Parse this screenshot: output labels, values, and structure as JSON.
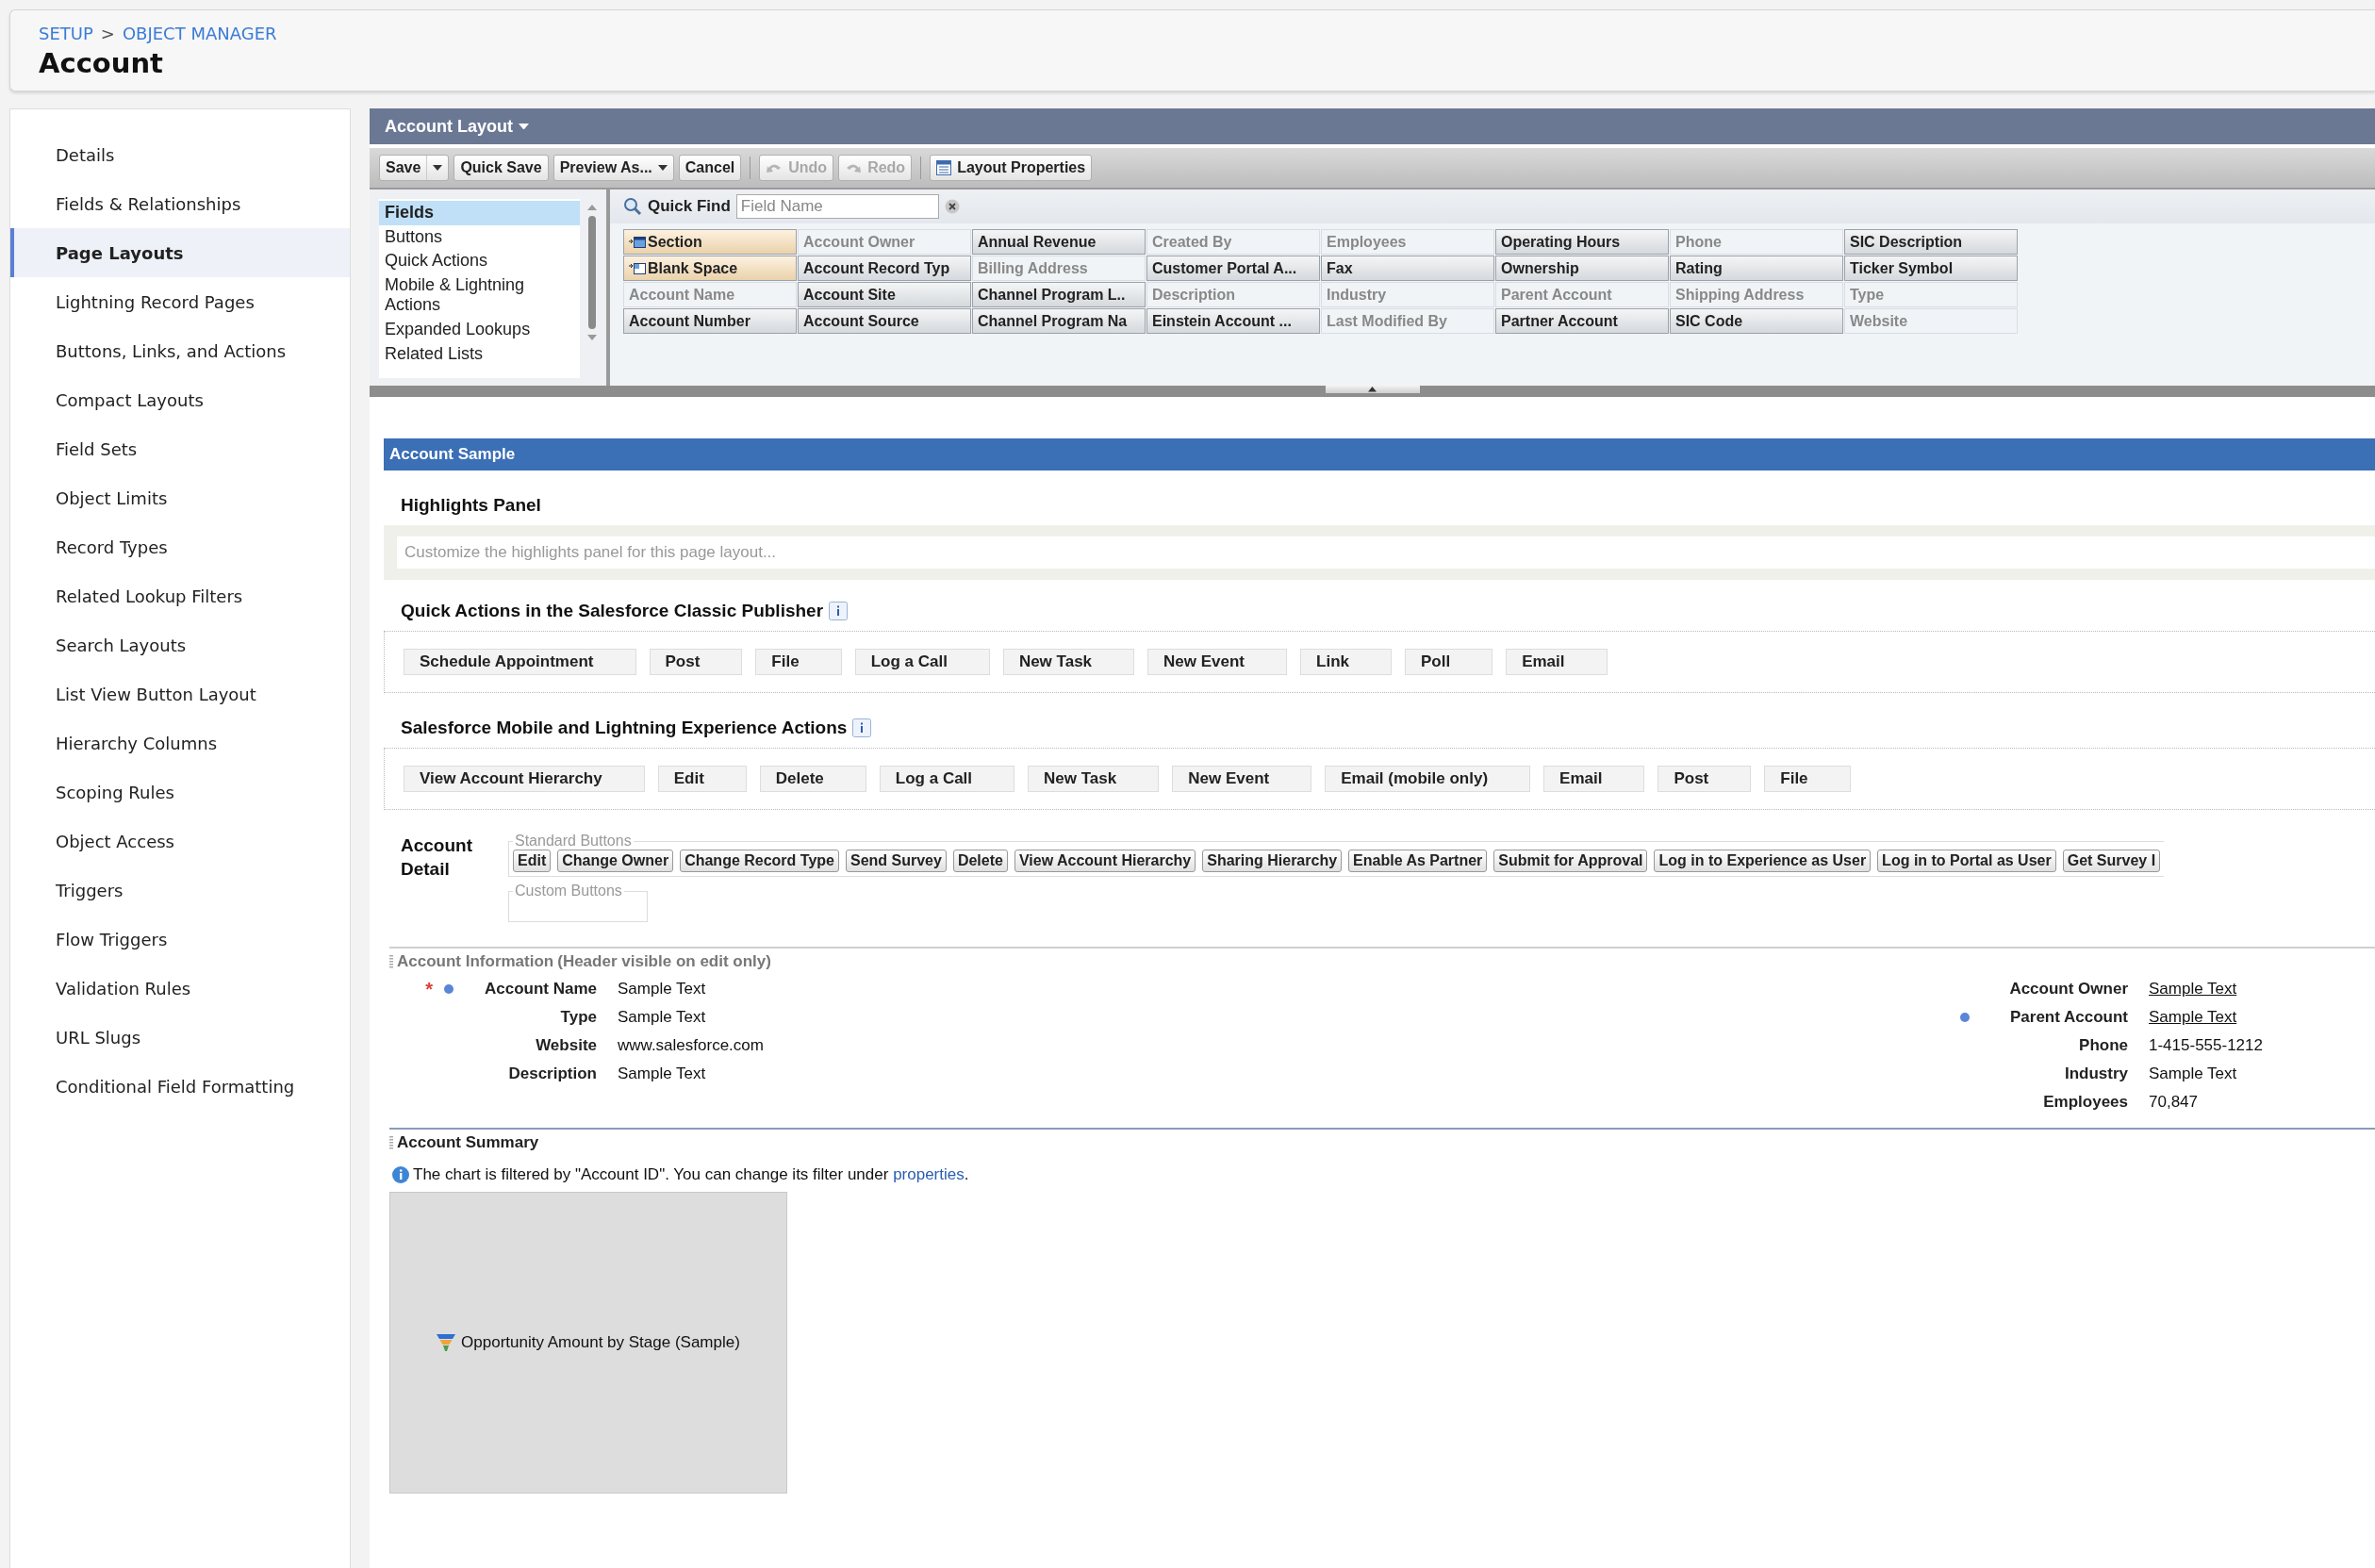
{
  "header": {
    "breadcrumb": [
      {
        "label": "SETUP"
      },
      {
        "label": "OBJECT MANAGER"
      }
    ],
    "separator": ">",
    "title": "Account"
  },
  "sidebar": {
    "items": [
      {
        "label": "Details",
        "selected": false
      },
      {
        "label": "Fields & Relationships",
        "selected": false
      },
      {
        "label": "Page Layouts",
        "selected": true
      },
      {
        "label": "Lightning Record Pages",
        "selected": false
      },
      {
        "label": "Buttons, Links, and Actions",
        "selected": false
      },
      {
        "label": "Compact Layouts",
        "selected": false
      },
      {
        "label": "Field Sets",
        "selected": false
      },
      {
        "label": "Object Limits",
        "selected": false
      },
      {
        "label": "Record Types",
        "selected": false
      },
      {
        "label": "Related Lookup Filters",
        "selected": false
      },
      {
        "label": "Search Layouts",
        "selected": false
      },
      {
        "label": "List View Button Layout",
        "selected": false
      },
      {
        "label": "Hierarchy Columns",
        "selected": false
      },
      {
        "label": "Scoping Rules",
        "selected": false
      },
      {
        "label": "Object Access",
        "selected": false
      },
      {
        "label": "Triggers",
        "selected": false
      },
      {
        "label": "Flow Triggers",
        "selected": false
      },
      {
        "label": "Validation Rules",
        "selected": false
      },
      {
        "label": "URL Slugs",
        "selected": false
      },
      {
        "label": "Conditional Field Formatting",
        "selected": false
      }
    ]
  },
  "layout_editor": {
    "title": "Account Layout",
    "toolbar": [
      {
        "label": "Save",
        "kind": "split",
        "disabled": false
      },
      {
        "label": "Quick Save",
        "kind": "plain",
        "disabled": false
      },
      {
        "label": "Preview As...",
        "kind": "menu",
        "disabled": false
      },
      {
        "label": "Cancel",
        "kind": "plain",
        "disabled": false
      },
      {
        "kind": "separator"
      },
      {
        "label": "Undo",
        "kind": "undo",
        "disabled": true
      },
      {
        "label": "Redo",
        "kind": "redo",
        "disabled": true
      },
      {
        "kind": "separator"
      },
      {
        "label": "Layout Properties",
        "kind": "properties",
        "disabled": false
      }
    ],
    "categories": [
      {
        "label": "Fields",
        "selected": true
      },
      {
        "label": "Buttons",
        "selected": false
      },
      {
        "label": "Quick Actions",
        "selected": false
      },
      {
        "label": "Mobile & Lightning Actions",
        "selected": false
      },
      {
        "label": "Expanded Lookups",
        "selected": false
      },
      {
        "label": "Related Lists",
        "selected": false
      }
    ],
    "quick_find": {
      "label": "Quick Find",
      "placeholder": "Field Name"
    },
    "fields": [
      {
        "label": "Section",
        "kind": "section",
        "placed": false
      },
      {
        "label": "Account Owner",
        "kind": "field",
        "placed": true
      },
      {
        "label": "Annual Revenue",
        "kind": "field",
        "placed": false
      },
      {
        "label": "Created By",
        "kind": "field",
        "placed": true
      },
      {
        "label": "Employees",
        "kind": "field",
        "placed": true
      },
      {
        "label": "Operating Hours",
        "kind": "field",
        "placed": false
      },
      {
        "label": "Phone",
        "kind": "field",
        "placed": true
      },
      {
        "label": "SIC Description",
        "kind": "field",
        "placed": false
      },
      {
        "label": "Blank Space",
        "kind": "blank",
        "placed": false
      },
      {
        "label": "Account Record Typ",
        "kind": "field",
        "placed": false
      },
      {
        "label": "Billing Address",
        "kind": "field",
        "placed": true
      },
      {
        "label": "Customer Portal A...",
        "kind": "field",
        "placed": false
      },
      {
        "label": "Fax",
        "kind": "field",
        "placed": false
      },
      {
        "label": "Ownership",
        "kind": "field",
        "placed": false
      },
      {
        "label": "Rating",
        "kind": "field",
        "placed": false
      },
      {
        "label": "Ticker Symbol",
        "kind": "field",
        "placed": false
      },
      {
        "label": "Account Name",
        "kind": "field",
        "placed": true
      },
      {
        "label": "Account Site",
        "kind": "field",
        "placed": false
      },
      {
        "label": "Channel Program L..",
        "kind": "field",
        "placed": false
      },
      {
        "label": "Description",
        "kind": "field",
        "placed": true
      },
      {
        "label": "Industry",
        "kind": "field",
        "placed": true
      },
      {
        "label": "Parent Account",
        "kind": "field",
        "placed": true
      },
      {
        "label": "Shipping Address",
        "kind": "field",
        "placed": true
      },
      {
        "label": "Type",
        "kind": "field",
        "placed": true
      },
      {
        "label": "Account Number",
        "kind": "field",
        "placed": false
      },
      {
        "label": "Account Source",
        "kind": "field",
        "placed": false
      },
      {
        "label": "Channel Program Na",
        "kind": "field",
        "placed": false
      },
      {
        "label": "Einstein Account ...",
        "kind": "field",
        "placed": false
      },
      {
        "label": "Last Modified By",
        "kind": "field",
        "placed": true
      },
      {
        "label": "Partner Account",
        "kind": "field",
        "placed": false
      },
      {
        "label": "SIC Code",
        "kind": "field",
        "placed": false
      },
      {
        "label": "Website",
        "kind": "field",
        "placed": true
      }
    ]
  },
  "sample": {
    "title": "Account Sample",
    "highlights": {
      "title": "Highlights Panel",
      "placeholder": "Customize the highlights panel for this page layout..."
    },
    "classic_actions": {
      "title": "Quick Actions in the Salesforce Classic Publisher",
      "actions": [
        "Schedule Appointment",
        "Post",
        "File",
        "Log a Call",
        "New Task",
        "New Event",
        "Link",
        "Poll",
        "Email"
      ]
    },
    "lightning_actions": {
      "title": "Salesforce Mobile and Lightning Experience Actions",
      "actions": [
        "View Account Hierarchy",
        "Edit",
        "Delete",
        "Log a Call",
        "New Task",
        "New Event",
        "Email (mobile only)",
        "Email",
        "Post",
        "File"
      ]
    },
    "detail": {
      "title": "Account Detail",
      "standard_label": "Standard Buttons",
      "standard_buttons": [
        "Edit",
        "Change Owner",
        "Change Record Type",
        "Send Survey",
        "Delete",
        "View Account Hierarchy",
        "Sharing Hierarchy",
        "Enable As Partner",
        "Submit for Approval",
        "Log in to Experience as User",
        "Log in to Portal as User",
        "Get Survey I"
      ],
      "custom_label": "Custom Buttons"
    },
    "information": {
      "title": "Account Information",
      "note": "(Header visible on edit only)",
      "required_mark": "*",
      "left": [
        {
          "label": "Account Name",
          "value": "Sample Text",
          "required": true,
          "dot": true,
          "link": false
        },
        {
          "label": "Type",
          "value": "Sample Text",
          "required": false,
          "dot": false,
          "link": false
        },
        {
          "label": "Website",
          "value": "www.salesforce.com",
          "required": false,
          "dot": false,
          "link": false
        },
        {
          "label": "Description",
          "value": "Sample Text",
          "required": false,
          "dot": false,
          "link": false
        }
      ],
      "right": [
        {
          "label": "Account Owner",
          "value": "Sample Text",
          "required": false,
          "dot": false,
          "link": true
        },
        {
          "label": "Parent Account",
          "value": "Sample Text",
          "required": false,
          "dot": true,
          "link": true
        },
        {
          "label": "Phone",
          "value": "1-415-555-1212",
          "required": false,
          "dot": false,
          "link": false
        },
        {
          "label": "Industry",
          "value": "Sample Text",
          "required": false,
          "dot": false,
          "link": false
        },
        {
          "label": "Employees",
          "value": "70,847",
          "required": false,
          "dot": false,
          "link": false
        }
      ]
    },
    "summary": {
      "title": "Account Summary",
      "note": "The chart is filtered by \"Account ID\". You can change its filter under ",
      "link": "properties",
      "note_end": ".",
      "chart_label": "Opportunity Amount by Stage (Sample)"
    }
  }
}
